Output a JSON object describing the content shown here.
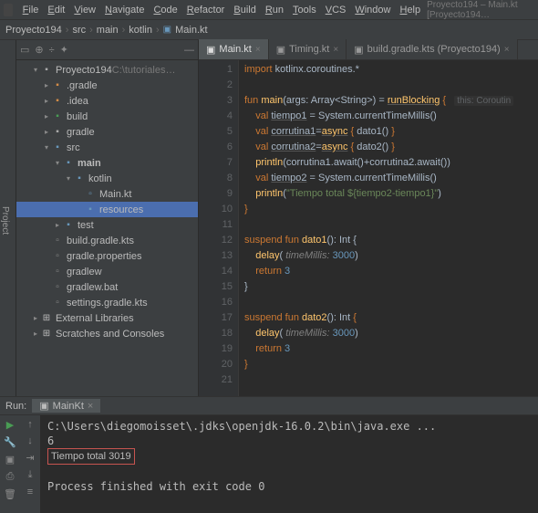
{
  "menubar": {
    "items": [
      "File",
      "Edit",
      "View",
      "Navigate",
      "Code",
      "Refactor",
      "Build",
      "Run",
      "Tools",
      "VCS",
      "Window",
      "Help"
    ],
    "project_label": "Proyecto194 – Main.kt [Proyecto194…"
  },
  "breadcrumb": {
    "parts": [
      "Proyecto194",
      "src",
      "main",
      "kotlin",
      "Main.kt"
    ]
  },
  "sidebar_tab": "Project",
  "tree": {
    "root": "Proyecto194",
    "root_hint": "C:\\tutoriales…",
    "items": [
      {
        "depth": 1,
        "arrow": "▾",
        "icon": "folder",
        "label": "Proyecto194",
        "dim_after": "root"
      },
      {
        "depth": 2,
        "arrow": "▸",
        "icon": "folder-o",
        "label": ".gradle"
      },
      {
        "depth": 2,
        "arrow": "▸",
        "icon": "folder-o",
        "label": ".idea"
      },
      {
        "depth": 2,
        "arrow": "▸",
        "icon": "folder-e",
        "label": "build"
      },
      {
        "depth": 2,
        "arrow": "▸",
        "icon": "folder",
        "label": "gradle"
      },
      {
        "depth": 2,
        "arrow": "▾",
        "icon": "folder-b",
        "label": "src"
      },
      {
        "depth": 3,
        "arrow": "▾",
        "icon": "folder-b",
        "label": "main",
        "bold": true
      },
      {
        "depth": 4,
        "arrow": "▾",
        "icon": "folder-b",
        "label": "kotlin"
      },
      {
        "depth": 5,
        "arrow": "",
        "icon": "file-kt",
        "label": "Main.kt"
      },
      {
        "depth": 5,
        "arrow": "",
        "icon": "folder-b",
        "label": "resources",
        "sel": true
      },
      {
        "depth": 3,
        "arrow": "▸",
        "icon": "folder-b",
        "label": "test"
      },
      {
        "depth": 2,
        "arrow": "",
        "icon": "file-g",
        "label": "build.gradle.kts"
      },
      {
        "depth": 2,
        "arrow": "",
        "icon": "file-g",
        "label": "gradle.properties"
      },
      {
        "depth": 2,
        "arrow": "",
        "icon": "file-g",
        "label": "gradlew"
      },
      {
        "depth": 2,
        "arrow": "",
        "icon": "file-g",
        "label": "gradlew.bat"
      },
      {
        "depth": 2,
        "arrow": "",
        "icon": "file-g",
        "label": "settings.gradle.kts"
      },
      {
        "depth": 1,
        "arrow": "▸",
        "icon": "lib",
        "label": "External Libraries"
      },
      {
        "depth": 1,
        "arrow": "▸",
        "icon": "lib",
        "label": "Scratches and Consoles"
      }
    ]
  },
  "tabs": [
    {
      "label": "Main.kt",
      "active": true
    },
    {
      "label": "Timing.kt",
      "active": false
    },
    {
      "label": "build.gradle.kts (Proyecto194)",
      "active": false
    }
  ],
  "code": {
    "lines": [
      {
        "n": 1,
        "html": "<span class='kw'>import</span> kotlinx.coroutines.*"
      },
      {
        "n": 2,
        "html": ""
      },
      {
        "n": 3,
        "html": "<span class='kw'>fun</span> <span class='fn'>main</span>(args: Array&lt;String&gt;) = <span class='fn ul'>runBlocking</span> <span class='kw'>{</span>   <span class='hint'>this: Coroutin</span>",
        "run": true
      },
      {
        "n": 4,
        "html": "    <span class='kw'>val</span> <span class='ul'>tiempo1</span> = System.currentTimeMillis()"
      },
      {
        "n": 5,
        "html": "    <span class='kw'>val</span> <span class='ul'>corrutina1</span>=<span class='fn ul'>async</span> <span class='kw'>{</span> dato1() <span class='kw'>}</span>",
        "sync": true
      },
      {
        "n": 6,
        "html": "    <span class='kw'>val</span> <span class='ul'>corrutina2</span>=<span class='fn ul'>async</span> <span class='kw'>{</span> dato2() <span class='kw'>}</span>",
        "sync": true
      },
      {
        "n": 7,
        "html": "    <span class='fn'>println</span>(corrutina1.await()+corrutina2.await())"
      },
      {
        "n": 8,
        "html": "    <span class='kw'>val</span> <span class='ul'>tiempo2</span> = System.currentTimeMillis()"
      },
      {
        "n": 9,
        "html": "    <span class='fn'>println</span>(<span class='str'>\"Tiempo total ${tiempo2-tiempo1}\"</span>)"
      },
      {
        "n": 10,
        "html": "<span class='kw'>}</span>"
      },
      {
        "n": 11,
        "html": ""
      },
      {
        "n": 12,
        "html": "<span class='kw'>suspend fun</span> <span class='fn'>dato1</span>(): Int {"
      },
      {
        "n": 13,
        "html": "    <span class='fn'>delay</span>( <span class='param'>timeMillis:</span> <span class='num'>3000</span>)",
        "sync": true
      },
      {
        "n": 14,
        "html": "    <span class='kw'>return</span> <span class='num'>3</span>"
      },
      {
        "n": 15,
        "html": "}"
      },
      {
        "n": 16,
        "html": ""
      },
      {
        "n": 17,
        "html": "<span class='kw'>suspend fun</span> <span class='fn'>dato2</span>(): Int <span class='kw'>{</span>"
      },
      {
        "n": 18,
        "html": "    <span class='fn'>delay</span>( <span class='param'>timeMillis:</span> <span class='num'>3000</span>)",
        "sync": true
      },
      {
        "n": 19,
        "html": "    <span class='kw'>return</span> <span class='num'>3</span>"
      },
      {
        "n": 20,
        "html": "<span class='kw'>}</span>"
      },
      {
        "n": 21,
        "html": ""
      }
    ]
  },
  "run": {
    "title": "Run:",
    "tab": "MainKt",
    "output": [
      "C:\\Users\\diegomoisset\\.jdks\\openjdk-16.0.2\\bin\\java.exe ...",
      "6",
      "",
      "",
      "Process finished with exit code 0"
    ],
    "highlight": "Tiempo total 3019"
  }
}
